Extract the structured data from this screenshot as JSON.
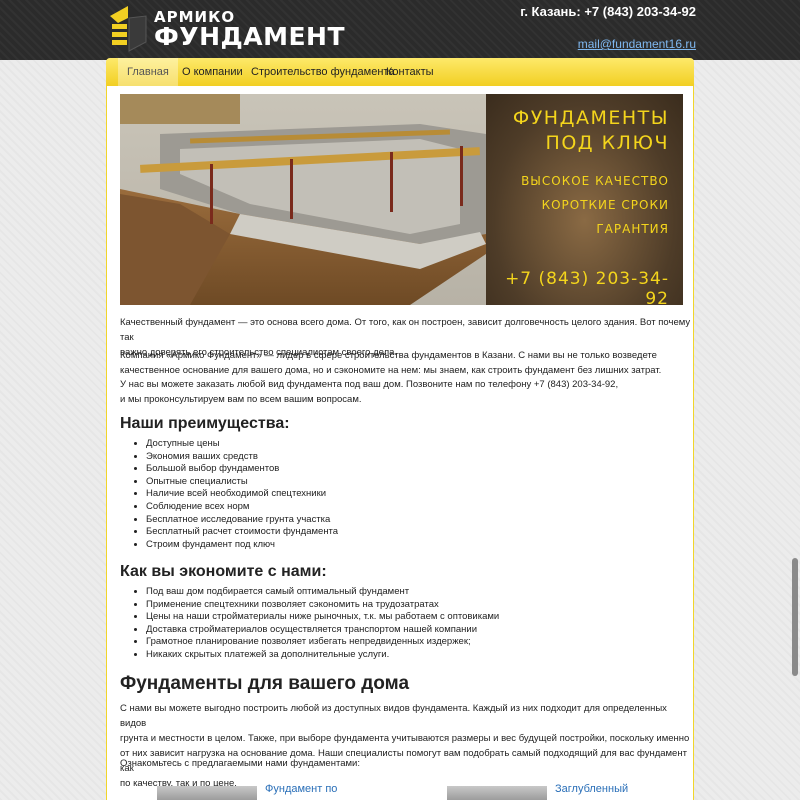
{
  "brand": {
    "small": "АРМИКО",
    "big": "ФУНДАМЕНТ",
    "colors": {
      "yellow": "#f2cf22",
      "dark": "#2b2b2b"
    }
  },
  "header": {
    "phone": "г. Казань: +7 (843) 203-34-92",
    "email": "mail@fundament16.ru"
  },
  "nav": {
    "items": [
      {
        "label": "Главная"
      },
      {
        "label": "О компании"
      },
      {
        "label": "Строительство фундамента"
      },
      {
        "label": "Контакты"
      }
    ]
  },
  "banner": {
    "title_line1": "ФУНДАМЕНТЫ",
    "title_line2": "ПОД КЛЮЧ",
    "features": [
      "ВЫСОКОЕ КАЧЕСТВО",
      "КОРОТКИЕ СРОКИ",
      "ГАРАНТИЯ"
    ],
    "phone": "+7 (843) 203-34-92"
  },
  "intro": {
    "p1_l1": "Качественный фундамент — это основа всего дома. От того, как он построен, зависит долговечность целого здания. Вот почему так",
    "p1_l2": "важно доверять его строительство специалистам своего дела.",
    "p2_l1": "Компания «Армико Фундамент» — лидер в сфере строительства фундаментов в Казани. С нами вы не только возведете",
    "p2_l2": "качественное основание для вашего дома, но и сэкономите на нем: мы знаем, как строить фундамент без лишних затрат.",
    "p3_l1": "У нас вы можете заказать любой вид фундамента под ваш дом. Позвоните нам по телефону +7 (843) 203-34-92,",
    "p3_l2": "и мы проконсультируем вам по всем вашим вопросам."
  },
  "advantages": {
    "heading": "Наши преимущества:",
    "items": [
      "Доступные цены",
      "Экономия ваших средств",
      "Большой выбор фундаментов",
      "Опытные специалисты",
      "Наличие всей необходимой спецтехники",
      "Соблюдение всех норм",
      "Бесплатное исследование грунта участка",
      "Бесплатный расчет стоимости фундамента",
      "Строим фундамент под ключ"
    ]
  },
  "savings": {
    "heading": "Как вы экономите с нами:",
    "items": [
      "Под ваш дом подбирается самый оптимальный фундамент",
      "Применение спецтехники позволяет сэкономить на трудозатратах",
      "Цены на наши стройматериалы ниже рыночных, т.к. мы работаем с оптовиками",
      "Доставка стройматериалов осуществляется транспортом нашей компании",
      "Грамотное планирование позволяет избегать непредвиденных издержек;",
      "Никаких скрытых платежей за дополнительные услуги."
    ]
  },
  "foundations": {
    "heading": "Фундаменты для вашего дома",
    "p1_l1": "С нами вы можете выгодно построить любой из доступных видов фундамента. Каждый из них подходит для определенных видов",
    "p1_l2": "грунта и местности в целом. Также, при выборе фундамента учитываются размеры и вес будущей постройки, поскольку именно",
    "p1_l3": "от них зависит нагрузка на основание дома. Наши специалисты помогут вам подобрать самый подходящий для вас фундамент как",
    "p1_l4": "по качеству, так и по цене.",
    "p2": "Ознакомьтесь с предлагаемыми нами фундаментами:",
    "link1": "Фундамент по",
    "link2": "Заглубленный"
  }
}
